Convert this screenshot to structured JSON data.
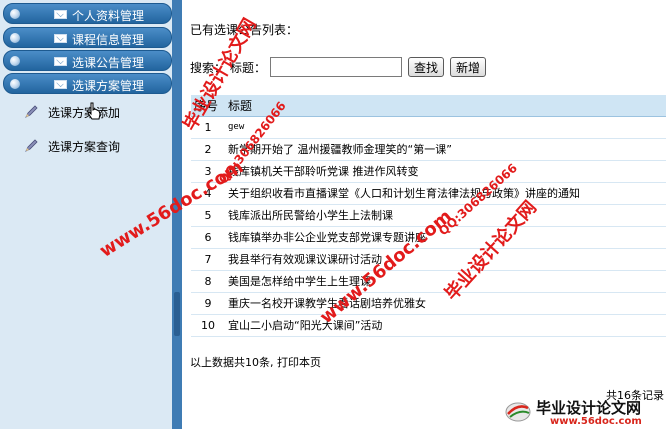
{
  "sidebar": {
    "menu": [
      {
        "label": "个人资料管理"
      },
      {
        "label": "课程信息管理"
      },
      {
        "label": "选课公告管理"
      },
      {
        "label": "选课方案管理"
      }
    ],
    "sub_items": [
      {
        "label": "选课方案添加"
      },
      {
        "label": "选课方案查询"
      }
    ]
  },
  "main": {
    "heading": "已有选课公告列表：",
    "search": {
      "label": "搜索：",
      "field_label": "标题：",
      "value": "",
      "search_button": "查找",
      "add_button": "新增"
    },
    "table": {
      "headers": [
        "序号",
        "标题"
      ],
      "rows": [
        {
          "num": "1",
          "title": "gew"
        },
        {
          "num": "2",
          "title": "新学期开始了 温州援疆教师金理笑的“第一课”"
        },
        {
          "num": "3",
          "title": "钱库镇机关干部聆听党课 推进作风转变"
        },
        {
          "num": "4",
          "title": "关于组织收看市直播课堂《人口和计划生育法律法规与政策》讲座的通知"
        },
        {
          "num": "5",
          "title": "钱库派出所民警给小学生上法制课"
        },
        {
          "num": "6",
          "title": "钱库镇举办非公企业党支部党课专题讲座"
        },
        {
          "num": "7",
          "title": "我县举行有效观课议课研讨活动"
        },
        {
          "num": "8",
          "title": "美国是怎样给中学生上生理课"
        },
        {
          "num": "9",
          "title": "重庆一名校开课教学生看话剧培养优雅女"
        },
        {
          "num": "10",
          "title": "宜山二小启动“阳光大课间”活动"
        }
      ]
    },
    "summary": "以上数据共10条, 打印本页",
    "total": "共16条记录"
  },
  "watermarks": {
    "site_cn": "毕业设计论文网",
    "site_url": "www.56doc.com",
    "qq": "QQ:306826066"
  },
  "brand": {
    "title": "毕业设计论文网",
    "url": "www.56doc.com"
  },
  "colors": {
    "menu_bar": "#2b6ea9",
    "sidebar_bg": "#dbe9f4",
    "divider": "#3f7cb4",
    "table_header": "#cfe5f4",
    "watermark": "#e21b1b"
  }
}
